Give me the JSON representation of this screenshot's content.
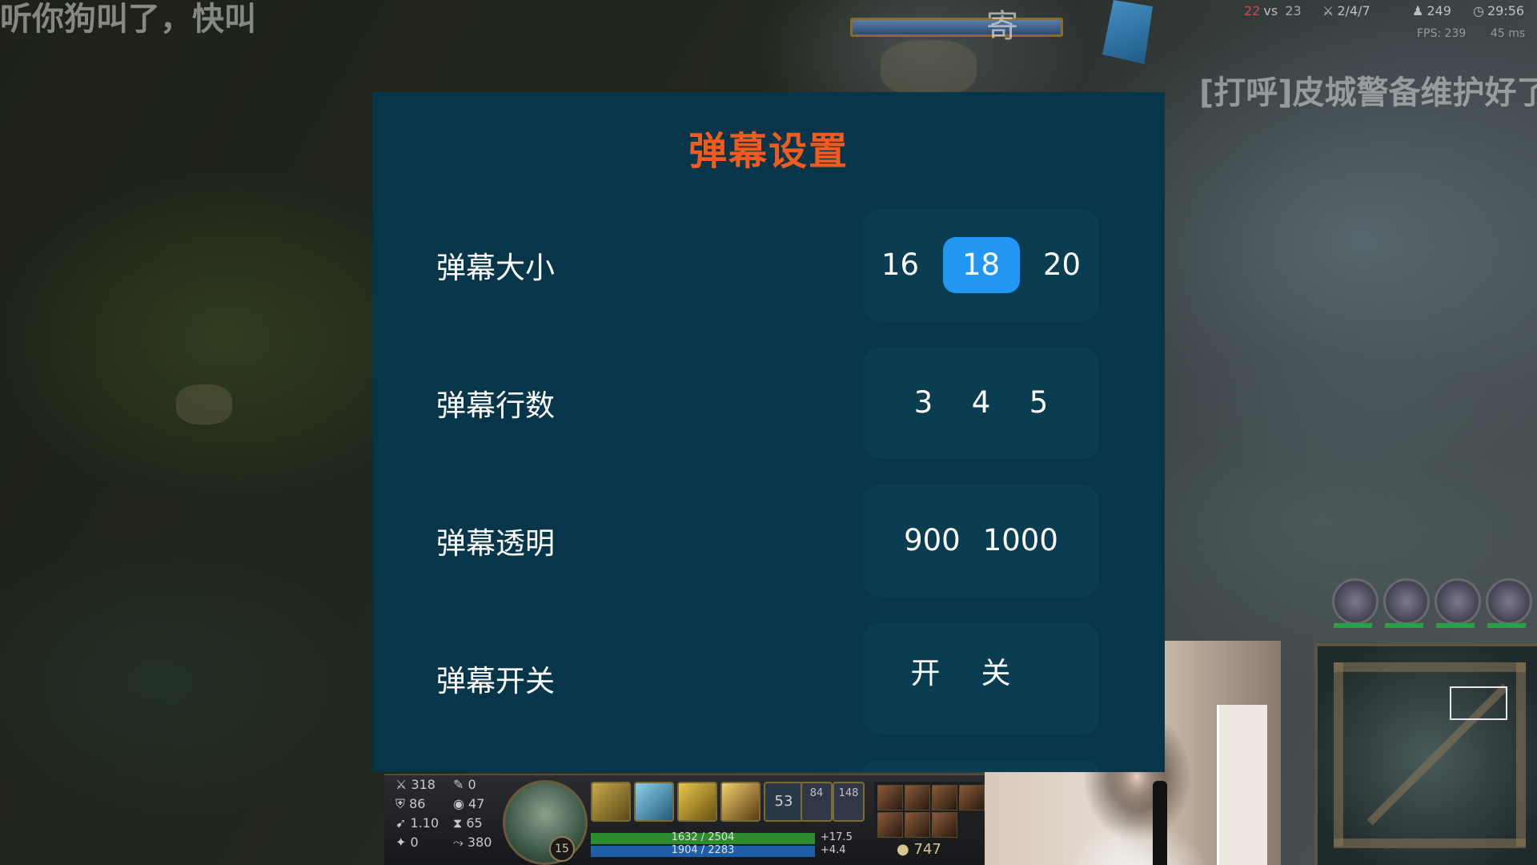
{
  "danmaku_overlay": {
    "line1": "听你狗叫了，快叫",
    "line2": "[打呼]皮城警备维护好了"
  },
  "game_hud_top": {
    "center_char": "寄",
    "kills_red": "22",
    "kills_vs": "vs",
    "kills_blue": "23",
    "kda": "2/4/7",
    "cs": "249",
    "time": "29:56",
    "fps": "FPS: 239",
    "ping": "45 ms"
  },
  "dialog": {
    "title": "弹幕设置",
    "rows": [
      {
        "label": "弹幕大小",
        "options": [
          "16",
          "18",
          "20"
        ],
        "selected": "18"
      },
      {
        "label": "弹幕行数",
        "options": [
          "3",
          "4",
          "5"
        ]
      },
      {
        "label": "弹幕透明",
        "options": [
          "900",
          "1000"
        ]
      },
      {
        "label": "弹幕开关",
        "options": [
          "开",
          "关"
        ]
      }
    ]
  },
  "game_hud_bottom": {
    "stats_left": [
      "318",
      "86",
      "1.10",
      "0"
    ],
    "stats_right": [
      "0",
      "47",
      "65",
      "380"
    ],
    "champion_level": "15",
    "ability_d_value": "53",
    "ability_f_value": "84",
    "ability_g_value": "148",
    "hp_text": "1632 / 2504",
    "mp_text": "1904 / 2283",
    "hp_regen": "+17.5",
    "mp_regen": "+4.4",
    "gold": "747"
  },
  "colors": {
    "dialog_bg": "#07364a",
    "title_color": "#f25a1f",
    "selected_option": "#2196f3"
  }
}
